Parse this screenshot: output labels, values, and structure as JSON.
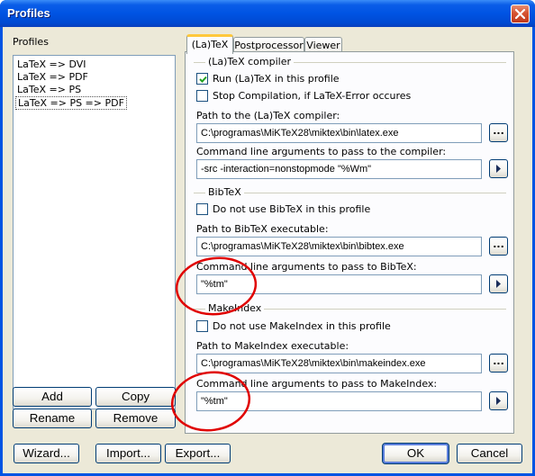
{
  "window": {
    "title": "Profiles"
  },
  "profiles": {
    "label": "Profiles",
    "items": [
      "LaTeX => DVI",
      "LaTeX => PDF",
      "LaTeX => PS",
      "LaTeX => PS => PDF"
    ],
    "selected_index": 3,
    "buttons": {
      "add": "Add",
      "copy": "Copy",
      "rename": "Rename",
      "remove": "Remove"
    }
  },
  "tabs": [
    {
      "label": "(La)TeX",
      "active": true
    },
    {
      "label": "Postprocessor",
      "active": false
    },
    {
      "label": "Viewer",
      "active": false
    }
  ],
  "latex": {
    "group_title": "(La)TeX compiler",
    "run_label": "Run (La)TeX in this profile",
    "run_checked": true,
    "stop_label": "Stop Compilation, if LaTeX-Error occures",
    "stop_checked": false,
    "path_label": "Path to the (La)TeX compiler:",
    "path_value": "C:\\programas\\MiKTeX28\\miktex\\bin\\latex.exe",
    "args_label": "Command line arguments to pass to the compiler:",
    "args_value": "-src -interaction=nonstopmode \"%Wm\""
  },
  "bibtex": {
    "group_title": "BibTeX",
    "disable_label": "Do not use BibTeX in this profile",
    "disable_checked": false,
    "path_label": "Path to BibTeX executable:",
    "path_value": "C:\\programas\\MiKTeX28\\miktex\\bin\\bibtex.exe",
    "args_label": "Command line arguments to pass to BibTeX:",
    "args_value": "\"%tm\""
  },
  "makeindex": {
    "group_title": "MakeIndex",
    "disable_label": "Do not use MakeIndex in this profile",
    "disable_checked": false,
    "path_label": "Path to MakeIndex executable:",
    "path_value": "C:\\programas\\MiKTeX28\\miktex\\bin\\makeindex.exe",
    "args_label": "Command line arguments to pass to MakeIndex:",
    "args_value": "\"%tm\""
  },
  "buttons": {
    "browse": "...",
    "wizard": "Wizard...",
    "import": "Import...",
    "export": "Export...",
    "ok": "OK",
    "cancel": "Cancel"
  },
  "colors": {
    "title_bar": "#0054e3",
    "dialog_bg": "#ece9d8",
    "annotation_red": "#e00000",
    "selection_blue": "#316ac5"
  }
}
